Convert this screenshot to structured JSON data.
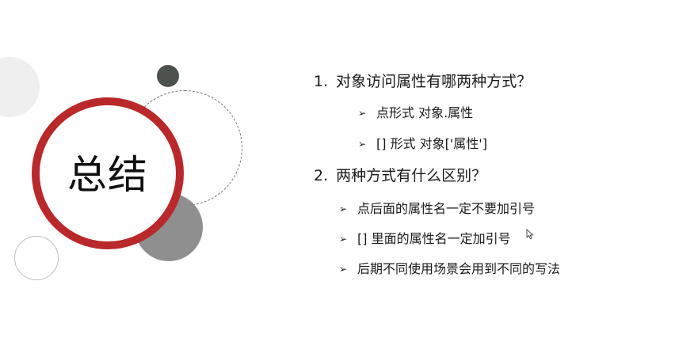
{
  "slide": {
    "title": "总结",
    "questions": [
      {
        "number": "1.",
        "text": "对象访问属性有哪两种方式？",
        "bullets": [
          "点形式  对象.属性",
          "[] 形式   对象['属性']"
        ]
      },
      {
        "number": "2.",
        "text": "两种方式有什么区别？",
        "bullets": [
          "点后面的属性名一定不要加引号",
          "[] 里面的属性名一定加引号",
          "后期不同使用场景会用到不同的写法"
        ]
      }
    ],
    "bullet_marker": "➢",
    "colors": {
      "accent_ring": "#b9292b",
      "dark_dot": "#4d524f",
      "gray_circle": "#8f8f8f",
      "light_circle": "#efefef"
    }
  }
}
